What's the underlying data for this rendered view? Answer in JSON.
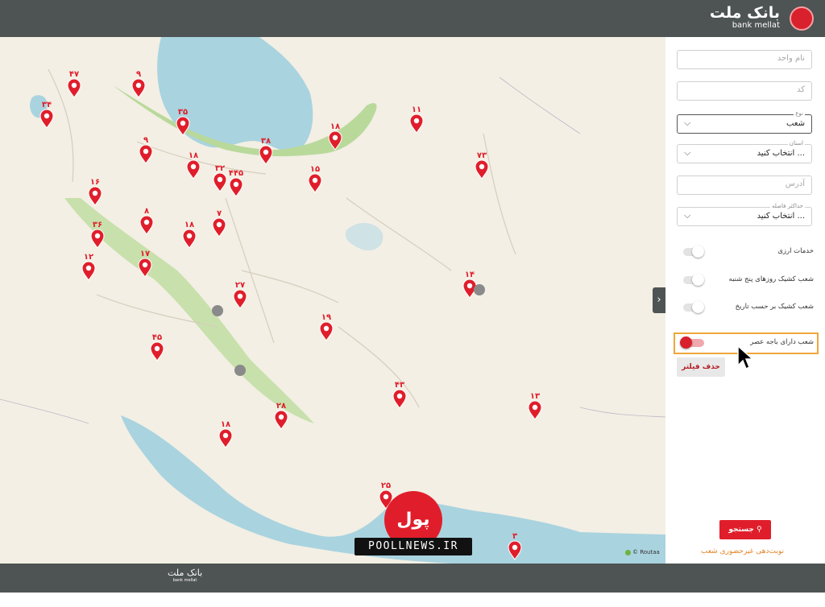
{
  "header": {
    "bank_name": "بانک ملت",
    "bank_name_latin": "bank mellat"
  },
  "filters": {
    "unit_name": {
      "placeholder": "نام واحد"
    },
    "code": {
      "placeholder": "کد"
    },
    "type": {
      "label": "نوع",
      "value": "شعب"
    },
    "province": {
      "label": "استان",
      "value": "انتخاب کنید ..."
    },
    "address": {
      "placeholder": "آدرس"
    },
    "max_distance": {
      "label": "حداکثر فاصله",
      "value": "انتخاب کنید ..."
    },
    "toggles": [
      {
        "label": "خدمات ارزی",
        "on": false
      },
      {
        "label": "شعب کشیک روزهای پنج شنبه",
        "on": false
      },
      {
        "label": "شعب کشیک بر حسب تاریخ",
        "on": false
      },
      {
        "label": "شعب دارای باجه عصر",
        "on": true
      }
    ],
    "clear_label": "حذف فیلتر",
    "search_label": "جستجو",
    "reserve_link": "نوبت‌دهی غیرحضوری شعب"
  },
  "map": {
    "attribution": "© Routaa",
    "markers": [
      {
        "label": "۴۷"
      },
      {
        "label": "۹"
      },
      {
        "label": "۳۴"
      },
      {
        "label": "۳۵"
      },
      {
        "label": "۱۱"
      },
      {
        "label": "۳۸"
      },
      {
        "label": "۱۸"
      },
      {
        "label": "۹"
      },
      {
        "label": "۱۸"
      },
      {
        "label": "۳۲"
      },
      {
        "label": "۴۴۵"
      },
      {
        "label": "۱۵"
      },
      {
        "label": "۷۳"
      },
      {
        "label": "۱۶"
      },
      {
        "label": "۸"
      },
      {
        "label": "۱۸"
      },
      {
        "label": "۷"
      },
      {
        "label": "۳۶"
      },
      {
        "label": "۱۲"
      },
      {
        "label": "۱۷"
      },
      {
        "label": "۱۴"
      },
      {
        "label": "۲۷"
      },
      {
        "label": "۱۹"
      },
      {
        "label": "۴۵"
      },
      {
        "label": "۴۳"
      },
      {
        "label": "۲۸"
      },
      {
        "label": "۱۳"
      },
      {
        "label": "۱۸"
      },
      {
        "label": "۲۵"
      },
      {
        "label": "۳"
      }
    ]
  },
  "watermark": {
    "brand": "پول نیوز",
    "url": "POOLLNEWS.IR"
  },
  "footer": {
    "bank_name": "بانک ملت",
    "bank_name_latin": "bank mellat"
  },
  "colors": {
    "header": "#4e5353",
    "accent": "#e01e2b",
    "highlight": "#f0a63a",
    "sea": "#a9d3df",
    "land": "#f3efe4",
    "green": "#b9d99b"
  }
}
